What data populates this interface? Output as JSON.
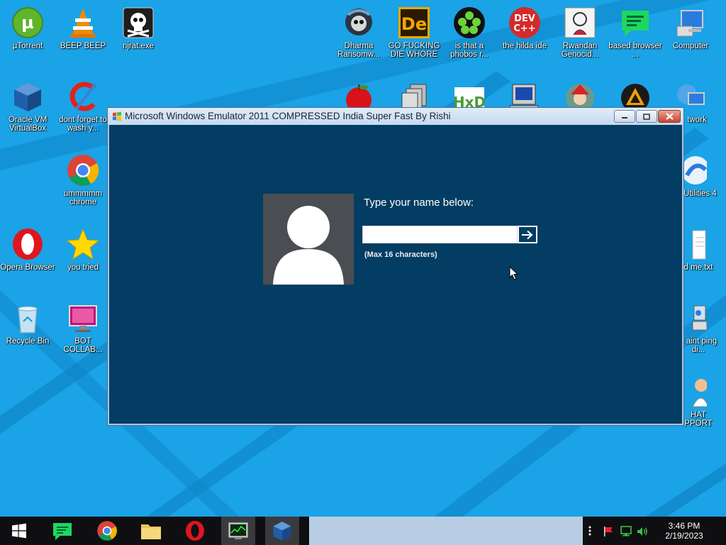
{
  "desktop": {
    "icons": [
      {
        "label": "µTorrent",
        "icon": "utorrent-icon"
      },
      {
        "label": "BEEP BEEP",
        "icon": "vlc-icon"
      },
      {
        "label": "njrat.exe",
        "icon": "skull-icon"
      },
      {
        "label": "Dharma Ransomw...",
        "icon": "ransomware-icon"
      },
      {
        "label": "GO FUCKING DIE WHORE",
        "icon": "de-app-icon"
      },
      {
        "label": "is that a phobos r...",
        "icon": "cicada-icon"
      },
      {
        "label": "the hilda ide",
        "icon": "devcpp-icon"
      },
      {
        "label": "Rwandan Genocid...",
        "icon": "meme-icon"
      },
      {
        "label": "based browser ...",
        "icon": "spotify-green-icon"
      },
      {
        "label": "Computer",
        "icon": "computer-icon"
      },
      {
        "label": "Oracle VM VirtualBox",
        "icon": "virtualbox-icon"
      },
      {
        "label": "dont forget to wash y...",
        "icon": "ccleaner-icon"
      },
      {
        "label": "ummmmm chrome",
        "icon": "chrome-icon"
      },
      {
        "label": "Opera Browser",
        "icon": "opera-icon"
      },
      {
        "label": "you tried",
        "icon": "star-icon"
      },
      {
        "label": "Recycle Bin",
        "icon": "recycle-bin-icon"
      },
      {
        "label": "BOT COLLAB...",
        "icon": "bot-collab-icon"
      },
      {
        "label": "twork",
        "icon": "network-icon"
      },
      {
        "label": "y Utilities 4",
        "icon": "utilities-icon"
      },
      {
        "label": "d me.txt",
        "icon": "text-file-icon"
      },
      {
        "label": "s aint ping di...",
        "icon": "ping-icon"
      },
      {
        "label": "HAT PPORT",
        "icon": "support-icon"
      },
      {
        "label": "",
        "icon": "apple-icon"
      },
      {
        "label": "",
        "icon": "stack-icon"
      },
      {
        "label": "",
        "icon": "hxd-icon"
      },
      {
        "label": "",
        "icon": "pc-icon"
      },
      {
        "label": "",
        "icon": "santa-icon"
      },
      {
        "label": "",
        "icon": "aimp-icon"
      }
    ]
  },
  "window": {
    "title": "Microsoft Windows Emulator 2011 COMPRESSED India Super Fast By Rishi",
    "login": {
      "prompt": "Type your name below:",
      "name_value": "",
      "hint": "(Max 16 characters)"
    }
  },
  "taskbar": {
    "clock_time": "3:46 PM",
    "clock_date": "2/19/2023",
    "pinned": [
      "windows-start-icon",
      "spotify-icon",
      "chrome-icon",
      "file-explorer-icon",
      "opera-icon",
      "task-manager-icon",
      "virtualbox-icon"
    ]
  },
  "colors": {
    "desktop_bg": "#1aa3e6",
    "window_client": "#033d63",
    "avatar_bg": "#4a4d52",
    "taskbar_bg": "#0f0f12"
  }
}
